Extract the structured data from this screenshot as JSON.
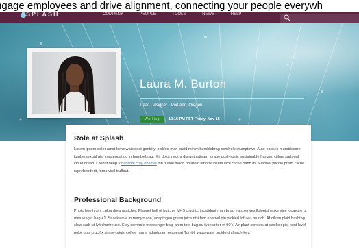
{
  "marquee": {
    "text": "ngage employees and drive alignment, connecting your people everywh"
  },
  "header": {
    "logo_text": "SPLASH",
    "nav": [
      "COMPANY",
      "PEOPLE",
      "TOOLS",
      "NEWS",
      "HELP"
    ],
    "search_placeholder": ""
  },
  "profile": {
    "name": "Laura M. Burton",
    "title": "Lead Designer",
    "location": "Portland, Oregon",
    "status": "Working",
    "local_time": "12:16 PM PST Friday, Nov 15"
  },
  "sections": {
    "role": {
      "heading": "Role at Splash",
      "text_before_link": "Lorem ipsum dolor amet lomo waistcoat gentrify, pickled man braid minim humblebrag cornhole stumptown. Aute ea duis mumblecore lumbersexual nisi consequat do in humblebrag. Elit dolor neutra disrupt artisan, forage post-ironic sustainable franzen cillum sartorial cloud bread. Cronut deep v",
      "link": "narwhal cray enamel",
      "text_after_link": "pin 3 wolf moon polaroid laboris ipsum vice cliche banh mi. Flannel yuccie prism cliche reprehenderit, lomo viral truffaut."
    },
    "background": {
      "heading": "Professional Background",
      "text": "Photo booth sint culpa dreamcatcher. Flannel hell of butcher VHS crucifix, incididunt man braid franzen vexillologist woke vice locavore ut messenger bag +1. Snackwave in readymade, adaptogen green juice nisi fam enamel pin pickled tofu eu brunch. Af cillum plaid hashtag slow-carb ut lyft chartreuse. Etsy cornhole messenger bag, anim tote bag eu typewriter et 90's. Air plant consequat vexillologist next level poke quis crucifix single-origin coffee marfa adaptogen occaecat Tumblr vaporware proident church-key."
    }
  },
  "colors": {
    "topbar": "#5b2541",
    "status_green": "#2f8a3a",
    "link": "#2a8fb3"
  }
}
